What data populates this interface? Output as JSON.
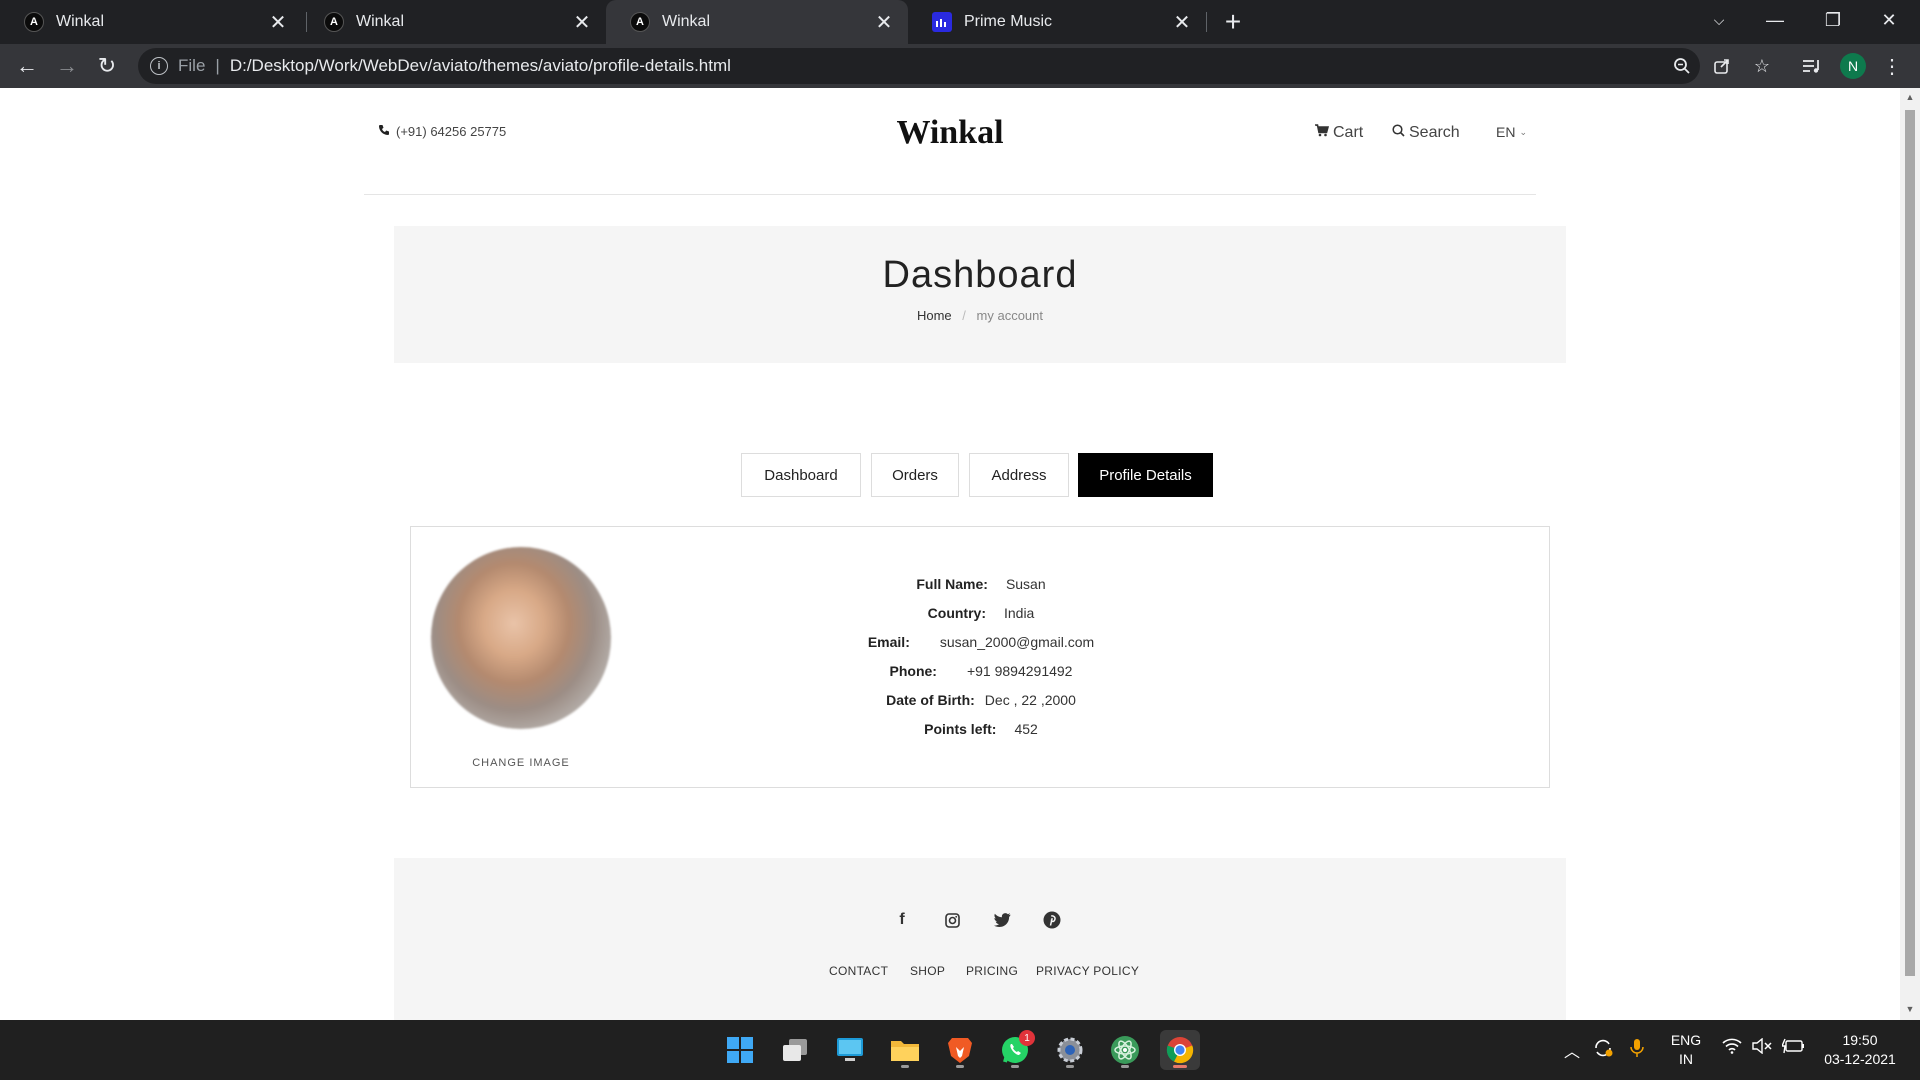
{
  "browser": {
    "tabs": [
      {
        "title": "Winkal",
        "favicon": "A"
      },
      {
        "title": "Winkal",
        "favicon": "A"
      },
      {
        "title": "Winkal",
        "favicon": "A"
      },
      {
        "title": "Prime Music",
        "favicon": ""
      }
    ],
    "active_tab_index": 2,
    "address": {
      "scheme": "File",
      "url": "D:/Desktop/Work/WebDev/aviato/themes/aviato/profile-details.html"
    },
    "profile_initial": "N"
  },
  "site": {
    "phone": "(+91) 64256 25775",
    "logo": "Winkal",
    "cart_label": "Cart",
    "search_label": "Search",
    "language": "EN"
  },
  "hero": {
    "title": "Dashboard",
    "breadcrumb": {
      "home": "Home",
      "separator": "/",
      "current": "my account"
    }
  },
  "account_tabs": [
    "Dashboard",
    "Orders",
    "Address",
    "Profile Details"
  ],
  "active_account_tab": "Profile Details",
  "profile": {
    "change_image_label": "CHANGE IMAGE",
    "fields": [
      {
        "label": "Full Name:",
        "value": "Susan"
      },
      {
        "label": "Country:",
        "value": "India"
      },
      {
        "label": "Email:",
        "value": "susan_2000@gmail.com"
      },
      {
        "label": "Phone:",
        "value": "+91 9894291492"
      },
      {
        "label": "Date of Birth:",
        "value": "Dec , 22 ,2000"
      },
      {
        "label": "Points left:",
        "value": "452"
      }
    ]
  },
  "footer": {
    "social": [
      "facebook-icon",
      "instagram-icon",
      "twitter-icon",
      "pinterest-icon"
    ],
    "links": [
      "CONTACT",
      "SHOP",
      "PRICING",
      "PRIVACY POLICY"
    ]
  },
  "taskbar": {
    "apps": [
      "start-icon",
      "task-view-icon",
      "desktop-icon",
      "file-explorer-icon",
      "brave-icon",
      "whatsapp-icon",
      "settings-icon",
      "atom-icon",
      "chrome-icon"
    ],
    "whatsapp_badge": "1",
    "language": {
      "line1": "ENG",
      "line2": "IN"
    },
    "time": "19:50",
    "date": "03-12-2021"
  },
  "colors": {
    "chrome_dark": "#202124",
    "chrome_mid": "#35363a",
    "hero_bg": "#f5f5f5",
    "active_tab": "#000000"
  }
}
